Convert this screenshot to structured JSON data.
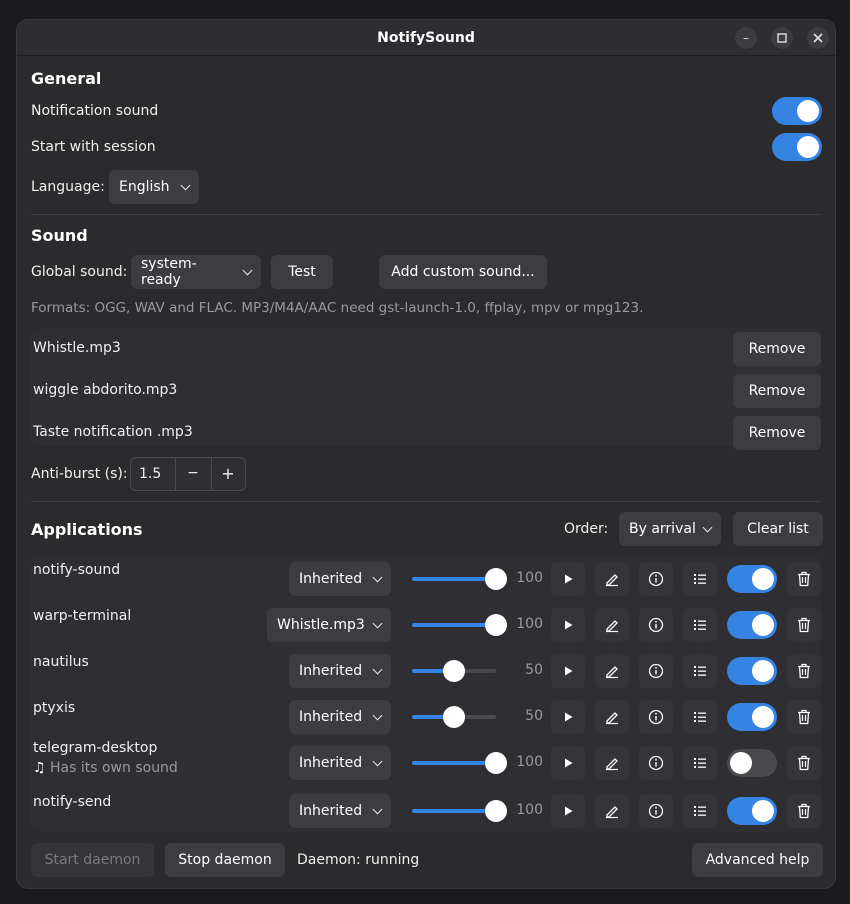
{
  "window": {
    "title": "NotifySound"
  },
  "general": {
    "heading": "General",
    "notification_sound_label": "Notification sound",
    "start_with_session_label": "Start with session",
    "notification_sound_on": true,
    "start_with_session_on": true,
    "language_label": "Language:",
    "language_value": "English"
  },
  "sound": {
    "heading": "Sound",
    "global_label": "Global sound:",
    "global_value": "system-ready",
    "test_label": "Test",
    "add_custom_label": "Add custom sound...",
    "formats_text": "Formats: OGG, WAV and FLAC. MP3/M4A/AAC need gst-launch-1.0, ffplay, mpv or mpg123.",
    "custom_sounds": [
      {
        "name": "Whistle.mp3",
        "remove_label": "Remove"
      },
      {
        "name": "wiggle abdorito.mp3",
        "remove_label": "Remove"
      },
      {
        "name": "Taste notification .mp3",
        "remove_label": "Remove"
      }
    ],
    "antiburst_label": "Anti-burst (s):",
    "antiburst_value": "1.5",
    "minus": "−",
    "plus": "+"
  },
  "applications": {
    "heading": "Applications",
    "order_label": "Order:",
    "order_value": "By arrival",
    "clear_label": "Clear list",
    "apps": [
      {
        "name": "notify-sound",
        "sound": "Inherited",
        "volume": "100",
        "volume_fraction": 1.0,
        "enabled": true,
        "note": ""
      },
      {
        "name": "warp-terminal",
        "sound": "Whistle.mp3",
        "volume": "100",
        "volume_fraction": 1.0,
        "enabled": true,
        "note": ""
      },
      {
        "name": "nautilus",
        "sound": "Inherited",
        "volume": "50",
        "volume_fraction": 0.5,
        "enabled": true,
        "note": ""
      },
      {
        "name": "ptyxis",
        "sound": "Inherited",
        "volume": "50",
        "volume_fraction": 0.5,
        "enabled": true,
        "note": ""
      },
      {
        "name": "telegram-desktop",
        "sound": "Inherited",
        "volume": "100",
        "volume_fraction": 1.0,
        "enabled": false,
        "note": "Has its own sound"
      },
      {
        "name": "notify-send",
        "sound": "Inherited",
        "volume": "100",
        "volume_fraction": 1.0,
        "enabled": true,
        "note": ""
      }
    ]
  },
  "footer": {
    "start_label": "Start daemon",
    "stop_label": "Stop daemon",
    "status_text": "Daemon: running",
    "advanced_label": "Advanced help"
  },
  "colors": {
    "accent": "#3584e4",
    "window_bg": "#2b2b2e",
    "button_bg": "#3d3d41"
  },
  "icons": [
    "minimize-icon",
    "maximize-icon",
    "close-icon",
    "play-icon",
    "edit-icon",
    "info-icon",
    "list-icon",
    "trash-icon",
    "music-note-icon",
    "chevron-down-icon"
  ]
}
